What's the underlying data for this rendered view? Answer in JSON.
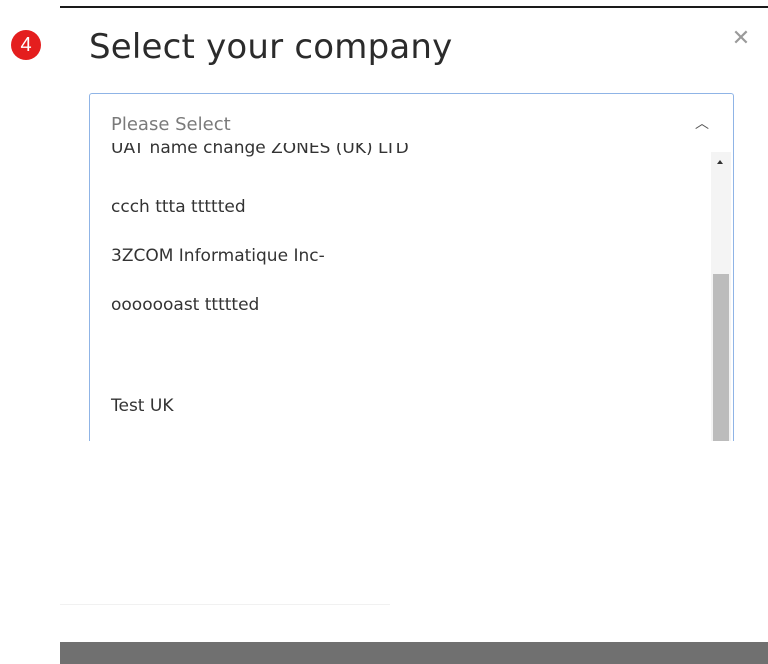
{
  "step_badge": "4",
  "dialog": {
    "title": "Select your company",
    "close_icon": "close-icon"
  },
  "select": {
    "placeholder": "Please Select",
    "chevron_icon": "chevron-up-icon",
    "options": [
      "UAT name change ZONES (UK) LTD",
      "ccch ttta ttttted",
      "3ZCOM Informatique Inc-",
      "ooooooast ttttted",
      "",
      "Test UK"
    ]
  },
  "colors": {
    "badge": "#e41e1e",
    "select_border": "#8fb4e6",
    "footer": "#707070"
  }
}
